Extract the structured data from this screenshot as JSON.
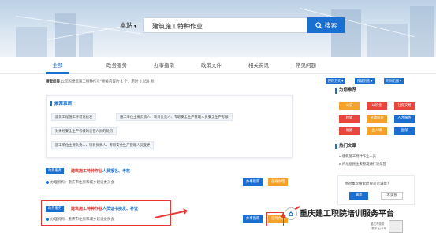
{
  "search": {
    "scope": "本站",
    "query": "建筑施工特种作业",
    "button": "搜索"
  },
  "tabs": [
    "全部",
    "政务服务",
    "办事指南",
    "政策文件",
    "相关资讯",
    "常见问题"
  ],
  "stats": {
    "prefix": "搜索结果",
    "text": "以您的建筑施工特种作业\"相关内容约 4 个，用时 0.359 秒"
  },
  "filters": [
    "按时方式",
    "按级别选",
    "时间范围"
  ],
  "recommended": {
    "title": "推荐事项",
    "chips": [
      "建筑工程施工许可证核发",
      "施工单位主要负责人、项目负责人、专职安全生产管理人员安全生产考核",
      "对未经安全生产考核的责任人员的处罚",
      "施工单位主要负责人、项目负责人、专职安全生产管理人员变更",
      "施工单位主要负责人、项目负责人、专职安全生产管理人员安全生产考核"
    ]
  },
  "results": [
    {
      "badge": "政务服务",
      "title_hl": "建筑施工特种作业",
      "title_rest": "人员报名、考核",
      "org": "办理机构：重庆市住房和城乡建设委员会",
      "btn1": "办事指南",
      "btn2": "在线办理"
    },
    {
      "badge": "政务服务",
      "title_hl": "建筑施工特种作业",
      "title_rest": "人员证书换发、补证",
      "org": "办理机构：重庆市住房和城乡建设委员会",
      "btn1": "办事指南",
      "btn2": "在线办理"
    }
  ],
  "sidebar": {
    "title1": "为您推荐",
    "grid": [
      {
        "label": "公安",
        "color": "#f4a22c"
      },
      {
        "label": "公积金",
        "color": "#e8453c"
      },
      {
        "label": "社保交易",
        "color": "#e8453c"
      },
      {
        "label": "税收",
        "color": "#e8453c"
      },
      {
        "label": "劳动就业",
        "color": "#f4a22c"
      },
      {
        "label": "人才服务",
        "color": "#1a6fd0"
      },
      {
        "label": "婚姻",
        "color": "#e8453c"
      },
      {
        "label": "出入境",
        "color": "#f4a22c"
      },
      {
        "label": "医保",
        "color": "#1a6fd0"
      },
      {
        "label": "交通",
        "color": "#f4a22c"
      },
      {
        "label": "民政",
        "color": "#f4a22c"
      },
      {
        "label": "教育",
        "color": "#1a6fd0"
      }
    ],
    "title2": "热门文章",
    "hot": [
      "建筑施工特种作业人员",
      "内地居民往来港澳通行证续签"
    ],
    "sat_question": "你对本次搜索结果是否满意？",
    "sat_yes": "满意",
    "sat_no": "不满意"
  },
  "watermark": "重庆建工职院培训服务平台",
  "mini_labels": [
    "重庆市政务",
    "(数字)公众号"
  ]
}
